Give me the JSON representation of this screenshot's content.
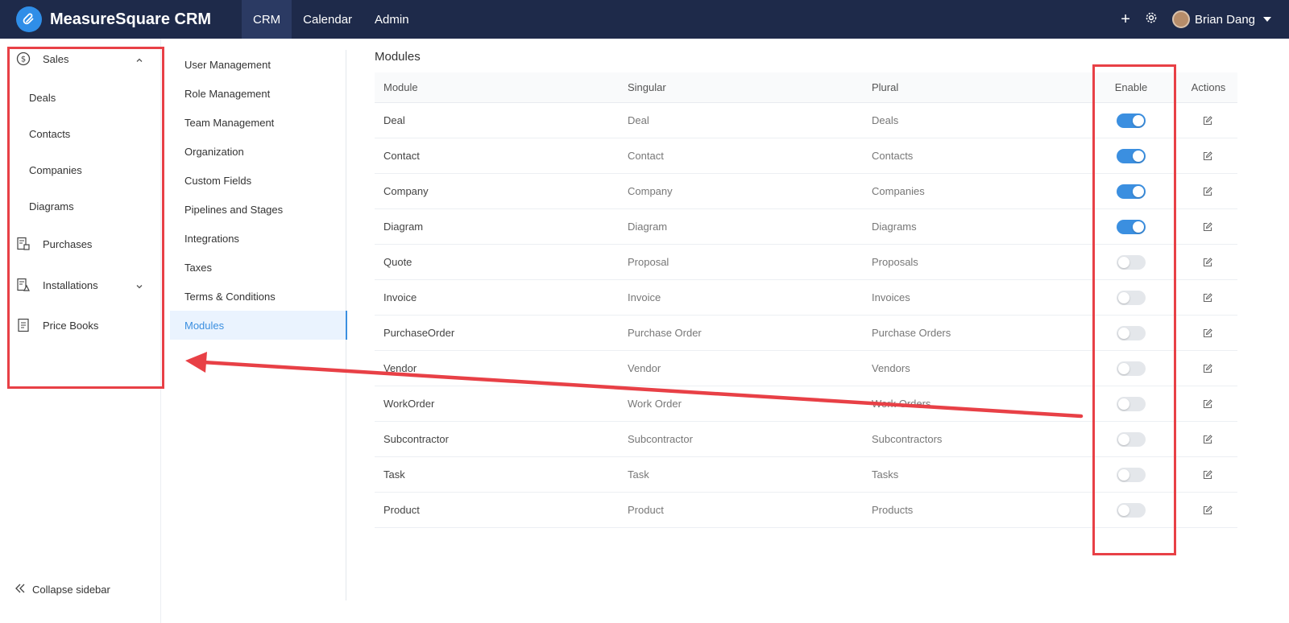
{
  "app": {
    "brand": "MeasureSquare CRM"
  },
  "topnav": {
    "items": [
      {
        "label": "CRM",
        "active": true
      },
      {
        "label": "Calendar",
        "active": false
      },
      {
        "label": "Admin",
        "active": false
      }
    ]
  },
  "user": {
    "name": "Brian Dang"
  },
  "sidebar": {
    "items": [
      {
        "label": "Sales",
        "icon": "dollar-circle-icon",
        "expanded": true
      },
      {
        "label": "Deals",
        "sub": true
      },
      {
        "label": "Contacts",
        "sub": true
      },
      {
        "label": "Companies",
        "sub": true
      },
      {
        "label": "Diagrams",
        "sub": true
      },
      {
        "label": "Purchases",
        "icon": "purchase-icon"
      },
      {
        "label": "Installations",
        "icon": "installation-icon",
        "expanded": false
      },
      {
        "label": "Price Books",
        "icon": "price-book-icon"
      }
    ],
    "collapse_label": "Collapse sidebar"
  },
  "settings_nav": {
    "items": [
      {
        "label": "User Management"
      },
      {
        "label": "Role Management"
      },
      {
        "label": "Team Management"
      },
      {
        "label": "Organization"
      },
      {
        "label": "Custom Fields"
      },
      {
        "label": "Pipelines and Stages"
      },
      {
        "label": "Integrations"
      },
      {
        "label": "Taxes"
      },
      {
        "label": "Terms & Conditions"
      },
      {
        "label": "Modules",
        "active": true
      }
    ]
  },
  "main": {
    "title": "Modules",
    "columns": {
      "module": "Module",
      "singular": "Singular",
      "plural": "Plural",
      "enable": "Enable",
      "actions": "Actions"
    },
    "rows": [
      {
        "module": "Deal",
        "singular": "Deal",
        "plural": "Deals",
        "enabled": true
      },
      {
        "module": "Contact",
        "singular": "Contact",
        "plural": "Contacts",
        "enabled": true
      },
      {
        "module": "Company",
        "singular": "Company",
        "plural": "Companies",
        "enabled": true
      },
      {
        "module": "Diagram",
        "singular": "Diagram",
        "plural": "Diagrams",
        "enabled": true
      },
      {
        "module": "Quote",
        "singular": "Proposal",
        "plural": "Proposals",
        "enabled": false
      },
      {
        "module": "Invoice",
        "singular": "Invoice",
        "plural": "Invoices",
        "enabled": false
      },
      {
        "module": "PurchaseOrder",
        "singular": "Purchase Order",
        "plural": "Purchase Orders",
        "enabled": false
      },
      {
        "module": "Vendor",
        "singular": "Vendor",
        "plural": "Vendors",
        "enabled": false
      },
      {
        "module": "WorkOrder",
        "singular": "Work Order",
        "plural": "Work Orders",
        "enabled": false
      },
      {
        "module": "Subcontractor",
        "singular": "Subcontractor",
        "plural": "Subcontractors",
        "enabled": false
      },
      {
        "module": "Task",
        "singular": "Task",
        "plural": "Tasks",
        "enabled": false
      },
      {
        "module": "Product",
        "singular": "Product",
        "plural": "Products",
        "enabled": false
      }
    ]
  },
  "colors": {
    "topbar": "#1e2a4a",
    "accent": "#3b8fe0",
    "annotation": "#e84046"
  }
}
